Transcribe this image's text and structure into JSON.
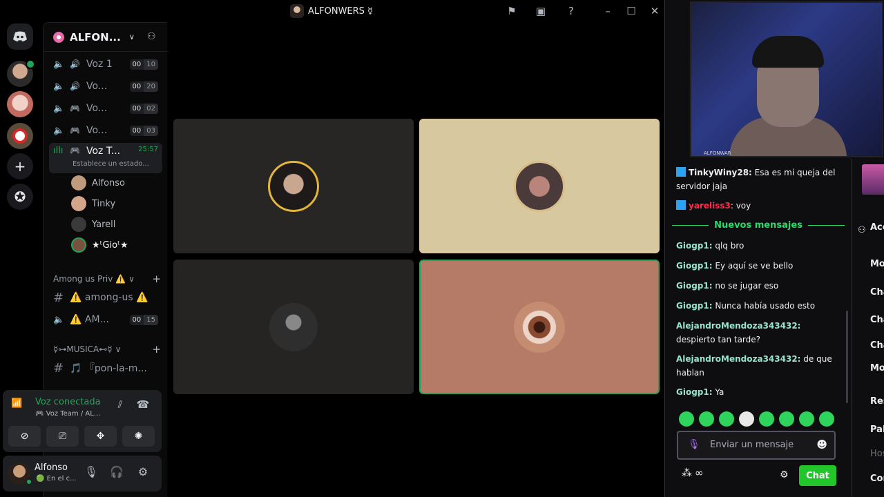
{
  "window": {
    "title": "ALFONWERS ☿",
    "controls": [
      "report-icon",
      "layout-icon",
      "help-icon",
      "minimize-icon",
      "maximize-icon",
      "close-icon"
    ]
  },
  "server": {
    "name": "ALFON..."
  },
  "voice_channels": [
    {
      "label": "Voz 1",
      "left": "00",
      "right": "10"
    },
    {
      "label": "Vo...",
      "left": "00",
      "right": "20"
    },
    {
      "label": "Vo...",
      "left": "00",
      "right": "02"
    },
    {
      "label": "Vo...",
      "left": "00",
      "right": "03"
    }
  ],
  "active_channel": {
    "label": "Voz T...",
    "timer": "25:57",
    "status": "Establece un estado..."
  },
  "members": [
    {
      "name": "Alfonso",
      "color": "#c19a7e"
    },
    {
      "name": "Tinky",
      "color": "#d4a48b"
    },
    {
      "name": "Yarell",
      "color": "#3a3a3a"
    },
    {
      "name": "★ᵗGioᵗ★",
      "color": "#7a5040"
    }
  ],
  "category_among": {
    "label": "Among us Priv ⚠️",
    "text_channel": "⚠️ among-us ⚠️",
    "voice": {
      "label": "⚠️ AM...",
      "left": "00",
      "right": "15"
    }
  },
  "category_musica": {
    "label": "☿⊶MUSICA⊷☿",
    "text_channel": "🎵 『pon-la-m..."
  },
  "voice_panel": {
    "title": "Voz conectada",
    "subtitle": "🎮 Voz Team / AL..."
  },
  "user_panel": {
    "name": "Alfonso",
    "status": "🟢 En el c..."
  },
  "tiles": [
    {
      "name": "tile-alfonso",
      "bg": "#282624"
    },
    {
      "name": "tile-tinky",
      "bg": "#d7c8a0"
    },
    {
      "name": "tile-yarell",
      "bg": "#262422"
    },
    {
      "name": "tile-gio",
      "bg": "#b67b66"
    }
  ],
  "twitch": {
    "watermark": "ALFONWAR",
    "chat_messages": [
      {
        "user": "TinkyWiny28:",
        "text": " Esa es mi queja del servidor jaja",
        "color": "#efeff1",
        "sub": true
      },
      {
        "user": "yareliss3",
        "text": ": voy",
        "color": "#ff2b4a",
        "sub": true
      }
    ],
    "divider": "Nuevos mensajes",
    "new_messages": [
      {
        "user": "Giogp1:",
        "text": " qlq bro",
        "color": "#97e4c9"
      },
      {
        "user": "Giogp1:",
        "text": " Ey aquí se ve bello",
        "color": "#97e4c9"
      },
      {
        "user": "Giogp1:",
        "text": " no se jugar eso",
        "color": "#97e4c9"
      },
      {
        "user": "Giogp1:",
        "text": " Nunca había usado esto",
        "color": "#97e4c9"
      },
      {
        "user": "AlejandroMendoza343432:",
        "text": " despierto tan tarde?",
        "color": "#97e4c9"
      },
      {
        "user": "AlejandroMendoza343432:",
        "text": " de que hablan",
        "color": "#97e4c9"
      },
      {
        "user": "Giogp1:",
        "text": " Ya",
        "color": "#97e4c9"
      }
    ],
    "input_placeholder": "Enviar un mensaje",
    "chat_button": "Chat",
    "right_menu": [
      "Acc car",
      "Modo",
      "Chat c",
      "Chat c",
      "Chat c",
      "Mode con IA",
      "Restri",
      "Palab",
      "Hoste",
      "Config"
    ]
  }
}
